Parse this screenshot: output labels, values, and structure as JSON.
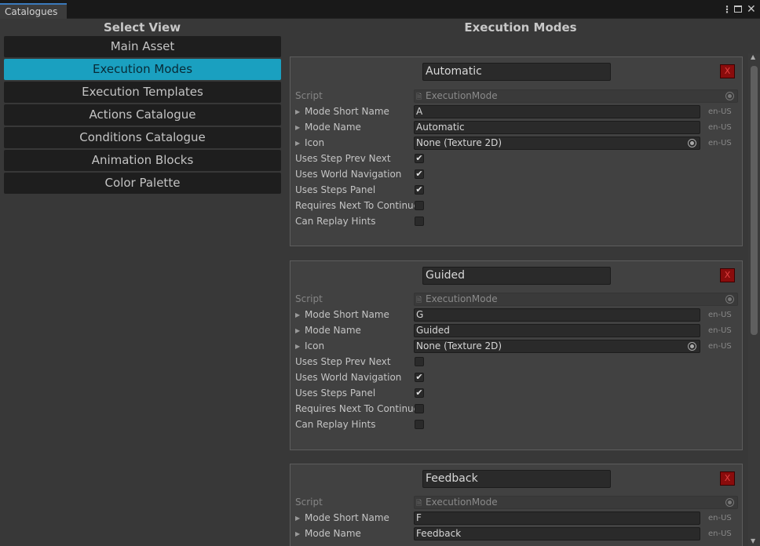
{
  "window": {
    "tab_title": "Catalogues",
    "kebab_glyph": "⋮",
    "close_glyph": "✕"
  },
  "left": {
    "title": "Select View",
    "items": [
      {
        "label": "Main Asset",
        "active": false
      },
      {
        "label": "Execution Modes",
        "active": true
      },
      {
        "label": "Execution Templates",
        "active": false
      },
      {
        "label": "Actions Catalogue",
        "active": false
      },
      {
        "label": "Conditions Catalogue",
        "active": false
      },
      {
        "label": "Animation Blocks",
        "active": false
      },
      {
        "label": "Color Palette",
        "active": false
      }
    ]
  },
  "right": {
    "title": "Execution Modes",
    "labels": {
      "script": "Script",
      "short_name": "Mode Short Name",
      "mode_name": "Mode Name",
      "icon": "Icon",
      "step_prev_next": "Uses Step Prev Next",
      "world_nav": "Uses World Navigation",
      "steps_panel": "Uses Steps Panel",
      "requires_next": "Requires Next To Continue",
      "replay_hints": "Can Replay Hints"
    },
    "delete_label": "X",
    "locale": "en-US",
    "fold_glyph": "▶",
    "check_glyph": "✔",
    "modes": [
      {
        "name": "Automatic",
        "script": "ExecutionMode",
        "short_name": "A",
        "mode_name": "Automatic",
        "icon": "None (Texture 2D)",
        "step_prev_next": true,
        "world_nav": true,
        "steps_panel": true,
        "requires_next": false,
        "replay_hints": false
      },
      {
        "name": "Guided",
        "script": "ExecutionMode",
        "short_name": "G",
        "mode_name": "Guided",
        "icon": "None (Texture 2D)",
        "step_prev_next": false,
        "world_nav": true,
        "steps_panel": true,
        "requires_next": false,
        "replay_hints": false
      },
      {
        "name": "Feedback",
        "script": "ExecutionMode",
        "short_name": "F",
        "mode_name": "Feedback"
      }
    ]
  },
  "colors": {
    "background": "#383838",
    "active_nav": "#1aa0c0",
    "nav_button": "#1e1e1e",
    "delete_button": "#8a0c0c",
    "tab_accent": "#3a79bb"
  }
}
